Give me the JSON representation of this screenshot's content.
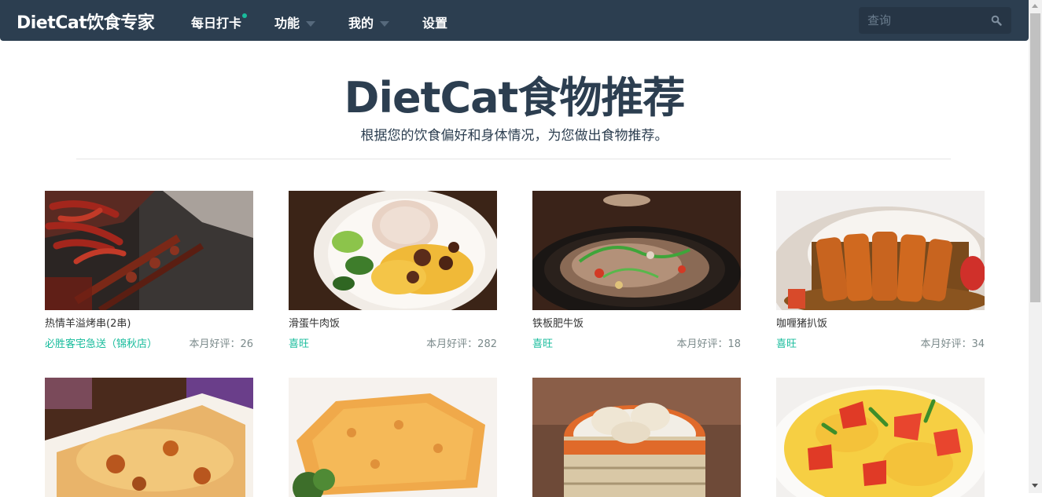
{
  "nav": {
    "brand": "DietCat饮食专家",
    "items": [
      {
        "label": "每日打卡",
        "dot": true
      },
      {
        "label": "功能",
        "dropdown": true
      },
      {
        "label": "我的",
        "dropdown": true
      },
      {
        "label": "设置"
      }
    ],
    "search_placeholder": "查询",
    "search_icon": "search-icon"
  },
  "header": {
    "title": "DietCat食物推荐",
    "subtitle": "根据您的饮食偏好和身体情况，为您做出食物推荐。"
  },
  "cards": [
    {
      "name": "热情羊溢烤串(2串)",
      "shop": "必胜客宅急送（锦秋店）",
      "rating": "本月好评：26"
    },
    {
      "name": "滑蛋牛肉饭",
      "shop": "喜旺",
      "rating": "本月好评：282"
    },
    {
      "name": "铁板肥牛饭",
      "shop": "喜旺",
      "rating": "本月好评：18"
    },
    {
      "name": "咖喱猪扒饭",
      "shop": "喜旺",
      "rating": "本月好评：34"
    },
    {
      "name": "",
      "shop": "",
      "rating": ""
    },
    {
      "name": "",
      "shop": "",
      "rating": ""
    },
    {
      "name": "",
      "shop": "",
      "rating": ""
    },
    {
      "name": "",
      "shop": "",
      "rating": ""
    }
  ],
  "colors": {
    "navbar": "#2c3e50",
    "accent": "#18bc9c",
    "muted": "#7b8a8b"
  }
}
